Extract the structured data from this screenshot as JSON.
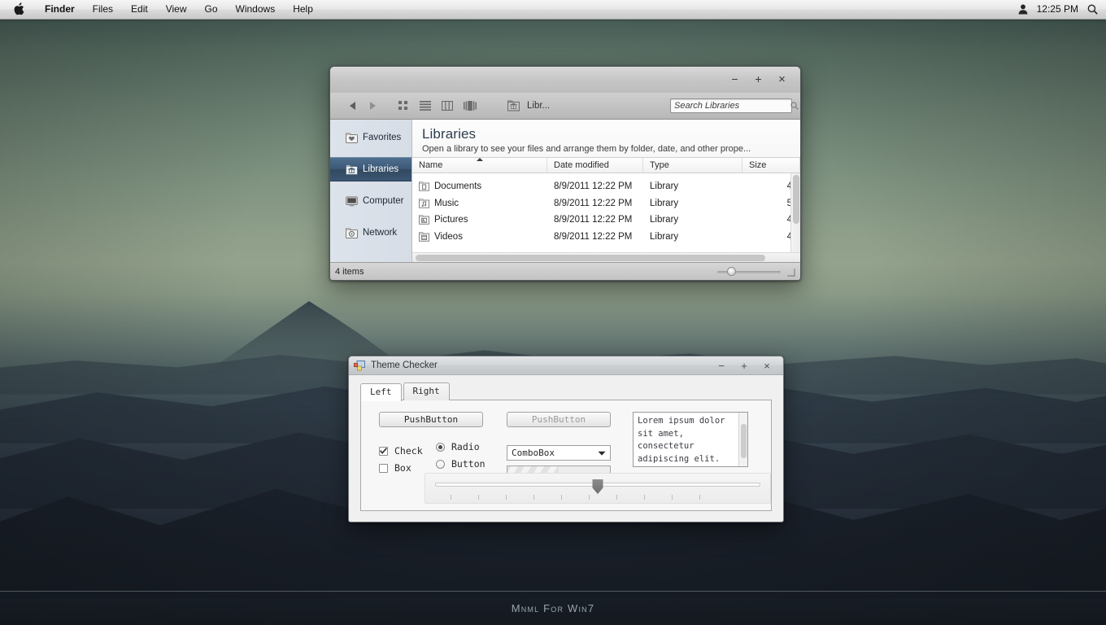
{
  "menubar": {
    "apple_logo": "",
    "items": [
      {
        "label": "Finder",
        "bold": true
      },
      {
        "label": "Files",
        "bold": false
      },
      {
        "label": "Edit",
        "bold": false
      },
      {
        "label": "View",
        "bold": false
      },
      {
        "label": "Go",
        "bold": false
      },
      {
        "label": "Windows",
        "bold": false
      },
      {
        "label": "Help",
        "bold": false
      }
    ],
    "time": "12:25 PM",
    "user_icon": "user-icon",
    "search_icon": "search-icon"
  },
  "explorer": {
    "window_controls": {
      "minimize": "−",
      "maximize": "+",
      "close": "×"
    },
    "toolbar": {
      "back_icon": "back-arrow-icon",
      "forward_icon": "forward-arrow-icon",
      "view_icon_grid": "icon-view-icon",
      "view_icon_list": "list-view-icon",
      "view_icon_columns": "column-view-icon",
      "view_icon_coverflow": "coverflow-view-icon",
      "breadcrumb_icon": "library-folder-icon",
      "breadcrumb_label": "Libr...",
      "search_placeholder": "Search Libraries",
      "search_value": ""
    },
    "sidebar": [
      {
        "label": "Favorites",
        "icon": "favorites-folder-icon",
        "selected": false
      },
      {
        "label": "Libraries",
        "icon": "libraries-folder-icon",
        "selected": true
      },
      {
        "label": "Computer",
        "icon": "computer-monitor-icon",
        "selected": false
      },
      {
        "label": "Network",
        "icon": "network-folder-icon",
        "selected": false
      }
    ],
    "header": {
      "title": "Libraries",
      "subtitle": "Open a library to see your files and arrange them by folder, date, and other prope..."
    },
    "columns": [
      {
        "label": "Name",
        "sorted": "asc"
      },
      {
        "label": "Date modified",
        "sorted": ""
      },
      {
        "label": "Type",
        "sorted": ""
      },
      {
        "label": "Size",
        "sorted": ""
      }
    ],
    "rows": [
      {
        "icon": "documents-library-icon",
        "name": "Documents",
        "date": "8/9/2011 12:22 PM",
        "type": "Library",
        "size": "4"
      },
      {
        "icon": "music-library-icon",
        "name": "Music",
        "date": "8/9/2011 12:22 PM",
        "type": "Library",
        "size": "5"
      },
      {
        "icon": "pictures-library-icon",
        "name": "Pictures",
        "date": "8/9/2011 12:22 PM",
        "type": "Library",
        "size": "4"
      },
      {
        "icon": "videos-library-icon",
        "name": "Videos",
        "date": "8/9/2011 12:22 PM",
        "type": "Library",
        "size": "4"
      }
    ],
    "statusbar": {
      "items_label": "4 items",
      "zoom_slider": "view-size-slider",
      "grip": "resize-grip"
    }
  },
  "theme_checker": {
    "title": "Theme Checker",
    "app_icon": "theme-checker-app-icon",
    "window_controls": {
      "minimize": "−",
      "maximize": "+",
      "close": "×"
    },
    "tabs": [
      {
        "label": "Left",
        "active": true
      },
      {
        "label": "Right",
        "active": false
      }
    ],
    "buttons": [
      {
        "label": "PushButton",
        "disabled": false
      },
      {
        "label": "PushButton",
        "disabled": true
      }
    ],
    "checkboxes": [
      {
        "label": "Check",
        "checked": true
      },
      {
        "label": "Box",
        "checked": false
      }
    ],
    "radios": [
      {
        "label": "Radio",
        "selected": true
      },
      {
        "label": "Button",
        "selected": false
      }
    ],
    "combobox": {
      "value": "ComboBox",
      "arrow_icon": "chevron-down-icon"
    },
    "progress": {
      "percent": "50"
    },
    "textarea": {
      "value": "Lorem ipsum dolor sit amet, consectetur adipiscing elit. In auctor."
    },
    "slider": {
      "value": "50"
    }
  },
  "dock": {
    "label": "Mnml For Win7"
  },
  "colors": {
    "selection_blue": "#3c5876",
    "menubar_text": "#111111",
    "dock_text": "#9aa6ab"
  }
}
